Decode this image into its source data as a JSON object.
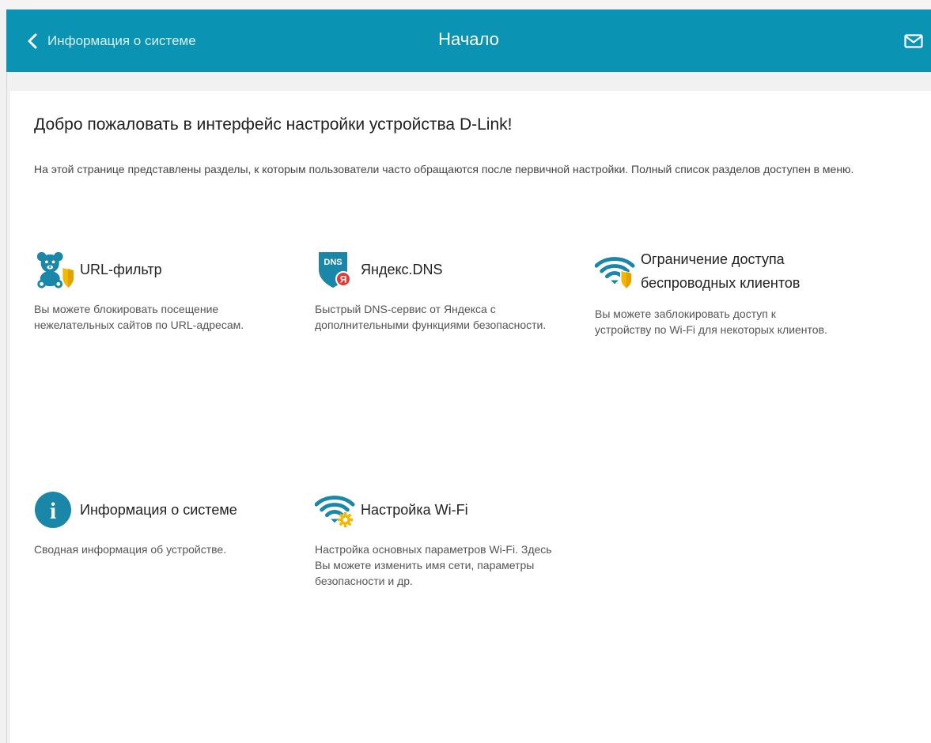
{
  "header": {
    "back_label": "Информация о системе",
    "title": "Начало",
    "mail_icon": "mail-icon",
    "back_icon": "chevron-left-icon",
    "color": "#0b93b4"
  },
  "welcome": {
    "heading": "Добро пожаловать в интерфейс настройки устройства D-Link!",
    "intro": "На этой странице представлены разделы, к которым пользователи часто обращаются после первичной настройки. Полный список разделов доступен в меню."
  },
  "tiles": [
    {
      "title": "URL-фильтр",
      "description": "Вы можете блокировать посещение нежелательных сайтов по URL-адресам.",
      "icon": "teddy-bear-shield-icon"
    },
    {
      "title": "Яндекс.DNS",
      "description": "Быстрый DNS-сервис от Яндекса с дополнительными функциями безопасности.",
      "icon": "yandex-dns-shield-icon",
      "icon_text": "DNS",
      "badge_text": "Я"
    },
    {
      "title": "Ограничение доступа беспроводных клиентов",
      "description": "Вы можете заблокировать доступ к устройству по Wi-Fi для некоторых клиентов.",
      "icon": "wifi-shield-icon"
    },
    {
      "title": "Информация о системе",
      "description": "Сводная информация об устройстве.",
      "icon": "info-icon",
      "icon_text": "i"
    },
    {
      "title": "Настройка Wi-Fi",
      "description": "Настройка основных параметров Wi-Fi. Здесь Вы можете изменить имя сети, параметры безопасности и др.",
      "icon": "wifi-gear-icon"
    }
  ],
  "colors": {
    "accent": "#0b93b4",
    "shield": "#f5b800",
    "badge": "#e53935"
  }
}
